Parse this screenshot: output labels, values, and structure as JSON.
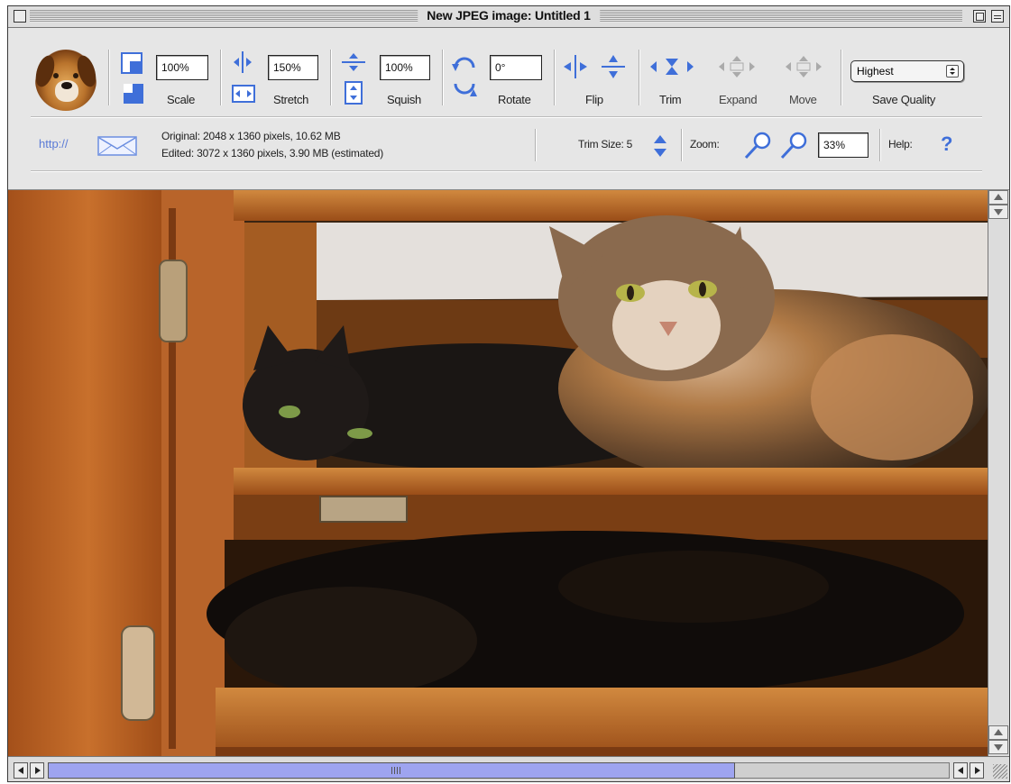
{
  "window": {
    "title": "New JPEG image: Untitled 1"
  },
  "toolbar": {
    "scale": {
      "value": "100%",
      "label": "Scale"
    },
    "stretch": {
      "value": "150%",
      "label": "Stretch"
    },
    "squish": {
      "value": "100%",
      "label": "Squish"
    },
    "rotate": {
      "value": "0°",
      "label": "Rotate"
    },
    "flip": {
      "label": "Flip"
    },
    "trim": {
      "label": "Trim"
    },
    "expand": {
      "label": "Expand"
    },
    "move": {
      "label": "Move"
    },
    "save_quality": {
      "selected": "Highest",
      "label": "Save Quality"
    }
  },
  "infobar": {
    "http_label": "http://",
    "original": "Original: 2048 x 1360 pixels, 10.62 MB",
    "edited": "Edited: 3072 x 1360 pixels, 3.90 MB (estimated)",
    "trim_size_label": "Trim Size: 5",
    "zoom_label": "Zoom:",
    "zoom_value": "33%",
    "help_label": "Help:",
    "help_icon": "?"
  },
  "photo": {
    "subject": "cats-in-wooden-cabinet"
  },
  "colors": {
    "accent_blue": "#3f6fd9",
    "thumb": "#9ea4f0"
  }
}
